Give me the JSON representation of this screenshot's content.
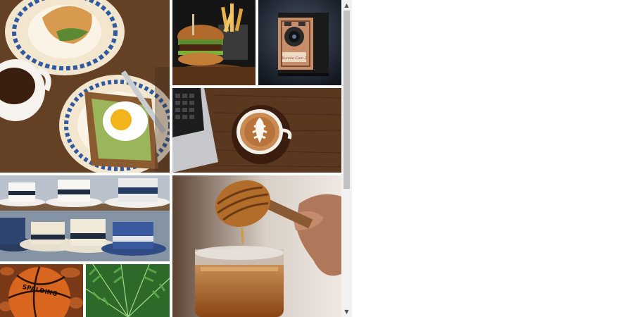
{
  "gallery": {
    "tiles": [
      {
        "id": "breakfast",
        "subject": "breakfast-plates-coffee-egg-toast"
      },
      {
        "id": "burger",
        "subject": "burger-and-fries"
      },
      {
        "id": "camera",
        "subject": "vintage-box-camera"
      },
      {
        "id": "latte",
        "subject": "latte-art-and-laptop"
      },
      {
        "id": "hats",
        "subject": "hats-on-shelves"
      },
      {
        "id": "honey",
        "subject": "honey-dipper-and-jar"
      },
      {
        "id": "ball",
        "subject": "basketball-on-leaves"
      },
      {
        "id": "fern",
        "subject": "fern-leaves"
      }
    ]
  },
  "images": {
    "camera_label": "Bonnie Cam 2",
    "ball_brand": "SPALDING"
  },
  "scrollbar": {
    "up_icon": "triangle-up-icon",
    "down_icon": "triangle-down-icon",
    "position_fraction": 0.0,
    "visible_fraction": 0.56
  },
  "colors": {
    "page_bg": "#ffffff",
    "scroll_track": "#f1f1f1",
    "scroll_thumb": "#c1c1c1"
  }
}
